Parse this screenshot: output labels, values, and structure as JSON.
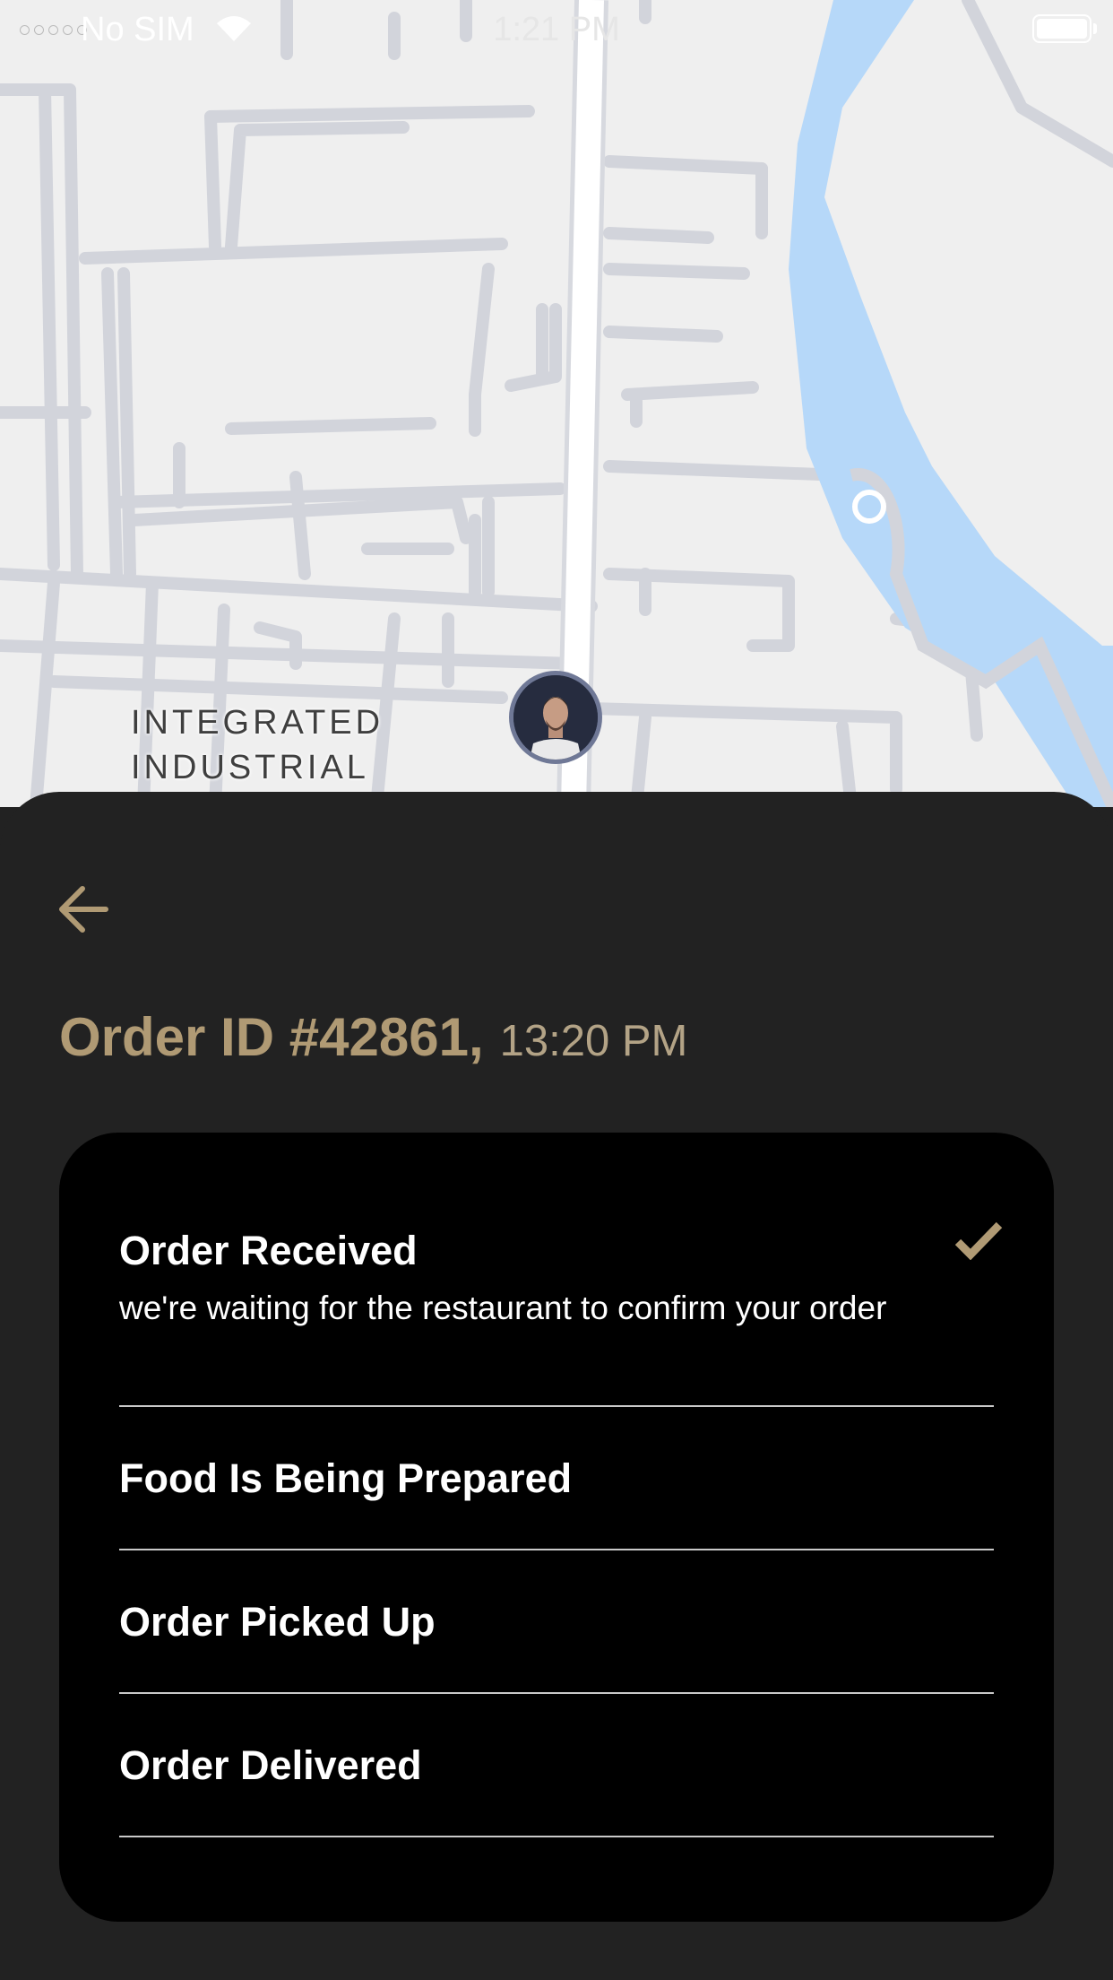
{
  "status_bar": {
    "carrier": "No SIM",
    "time": "1:21 PM",
    "wifi_icon": "wifi-icon",
    "battery_icon": "battery-icon"
  },
  "map": {
    "area_label_line1": "INTEGRATED",
    "area_label_line2": "INDUSTRIAL",
    "marker": "driver-avatar"
  },
  "sheet": {
    "back_icon": "arrow-left-icon",
    "order_id": "Order ID #42861,",
    "order_time": "13:20 PM",
    "steps": [
      {
        "title": "Order Received",
        "description": "we're waiting for the restaurant to confirm your order",
        "completed": true,
        "icon": "check-icon"
      },
      {
        "title": "Food Is Being Prepared",
        "completed": false
      },
      {
        "title": "Order Picked Up",
        "completed": false
      },
      {
        "title": "Order Delivered",
        "completed": false
      }
    ]
  },
  "colors": {
    "accent_gold": "#b09a74",
    "sheet_bg": "#222222",
    "card_bg": "#000000",
    "map_bg": "#efefef",
    "river": "#b6d8f9"
  }
}
